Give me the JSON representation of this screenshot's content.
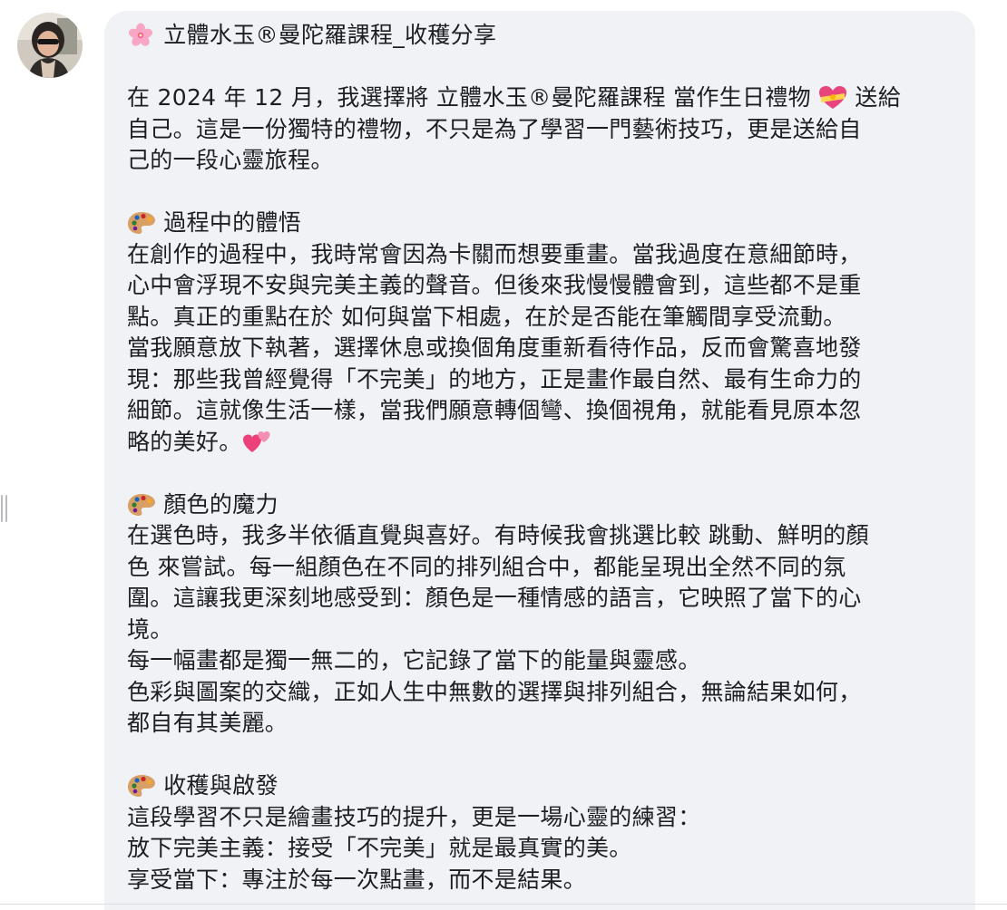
{
  "post": {
    "title": "立體水玉®曼陀羅課程_收穫分享",
    "intro": {
      "l1a": "在 2024 年 12 月，我選擇將 立體水玉®曼陀羅課程 當作生日禮物",
      "l1b": "送給",
      "l2": "自己。這是一份獨特的禮物，不只是為了學習一門藝術技巧，更是送給自",
      "l3": "己的一段心靈旅程。"
    },
    "section1": {
      "heading": "過程中的體悟",
      "lines": [
        "在創作的過程中，我時常會因為卡關而想要重畫。當我過度在意細節時，",
        "心中會浮現不安與完美主義的聲音。但後來我慢慢體會到，這些都不是重",
        "點。真正的重點在於 如何與當下相處，在於是否能在筆觸間享受流動。",
        "當我願意放下執著，選擇休息或換個角度重新看待作品，反而會驚喜地發",
        "現：那些我曾經覺得「不完美」的地方，正是畫作最自然、最有生命力的",
        "細節。這就像生活一樣，當我們願意轉個彎、換個視角，就能看見原本忽"
      ],
      "last_line": "略的美好。"
    },
    "section2": {
      "heading": "顏色的魔力",
      "lines": [
        "在選色時，我多半依循直覺與喜好。有時候我會挑選比較 跳動、鮮明的顏",
        "色 來嘗試。每一組顏色在不同的排列組合中，都能呈現出全然不同的氛",
        "圍。這讓我更深刻地感受到：顏色是一種情感的語言，它映照了當下的心",
        "境。",
        "每一幅畫都是獨一無二的，它記錄了當下的能量與靈感。",
        "色彩與圖案的交織，正如人生中無數的選擇與排列組合，無論結果如何，",
        "都自有其美麗。"
      ]
    },
    "section3": {
      "heading": "收穫與啟發",
      "lines": [
        "這段學習不只是繪畫技巧的提升，更是一場心靈的練習：",
        "放下完美主義：接受「不完美」就是最真實的美。",
        "享受當下：專注於每一次點畫，而不是結果。"
      ]
    }
  },
  "icons": {
    "title_emoji": "cherry-blossom-icon",
    "intro_emoji": "heart-with-ribbon-icon",
    "section_emoji": "artist-palette-icon",
    "end_emoji": "two-hearts-icon"
  },
  "colors": {
    "bubble_bg": "#f0f2f5",
    "text": "#1c1e21"
  }
}
